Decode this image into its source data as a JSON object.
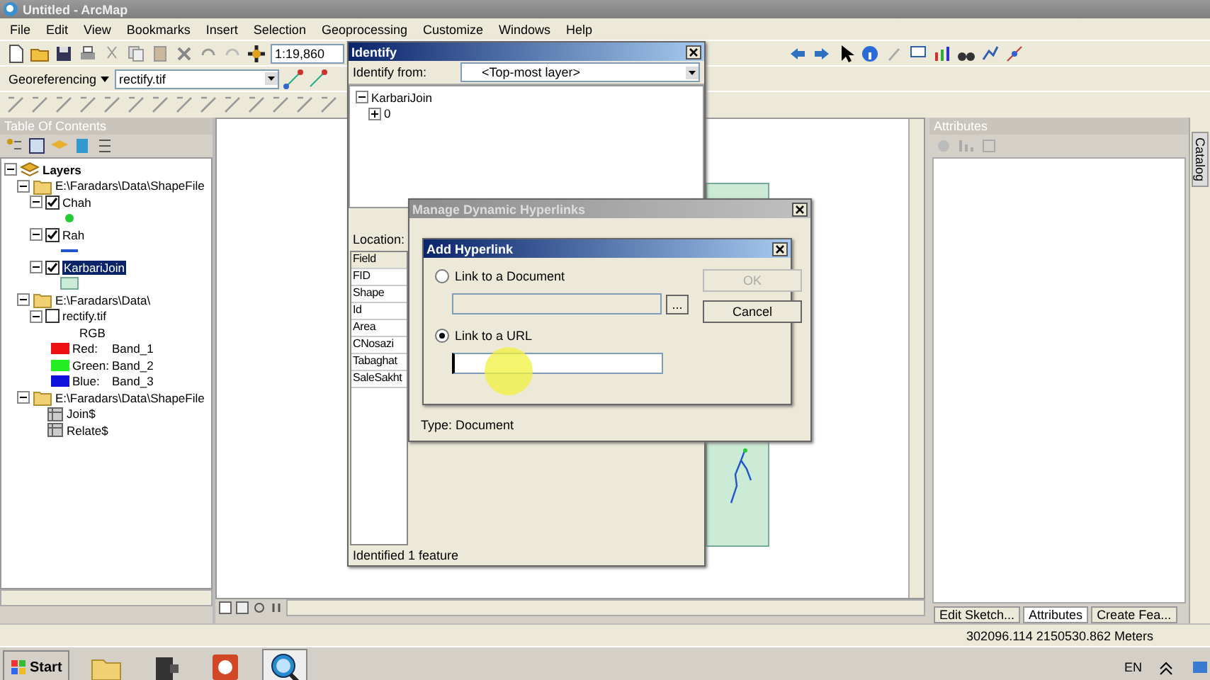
{
  "window": {
    "title": "Untitled - ArcMap"
  },
  "menu": [
    "File",
    "Edit",
    "View",
    "Bookmarks",
    "Insert",
    "Selection",
    "Geoprocessing",
    "Customize",
    "Windows",
    "Help"
  ],
  "standard_toolbar": {
    "scale": "1:19,860"
  },
  "georeferencing_toolbar": {
    "label": "Georeferencing",
    "layer": "rectify.tif"
  },
  "toc": {
    "title": "Table Of Contents",
    "tree": [
      {
        "kind": "group",
        "label": "Layers",
        "expanded": true,
        "children": [
          {
            "kind": "folder",
            "label": "E:\\Faradars\\Data\\ShapeFile",
            "expanded": true,
            "children": [
              {
                "kind": "layer",
                "label": "Chah",
                "checked": true,
                "selected": false,
                "expanded": true,
                "children": [
                  {
                    "kind": "point",
                    "color": "#22cc33"
                  }
                ]
              },
              {
                "kind": "layer",
                "label": "Rah",
                "checked": true,
                "selected": false,
                "expanded": true,
                "children": [
                  {
                    "kind": "line",
                    "color": "#2255cc"
                  }
                ]
              },
              {
                "kind": "layer",
                "label": "KarbariJoin",
                "checked": true,
                "selected": true,
                "expanded": true,
                "children": [
                  {
                    "kind": "fill",
                    "color": "#ccebd6"
                  }
                ]
              }
            ]
          },
          {
            "kind": "folder",
            "label": "E:\\Faradars\\Data\\",
            "expanded": true,
            "children": [
              {
                "kind": "layer",
                "label": "rectify.tif",
                "checked": false,
                "selected": false,
                "expanded": true,
                "children": [
                  {
                    "kind": "caption",
                    "label": "RGB"
                  },
                  {
                    "kind": "band",
                    "label": "Red:",
                    "value": "Band_1",
                    "color": "#ee1111"
                  },
                  {
                    "kind": "band",
                    "label": "Green:",
                    "value": "Band_2",
                    "color": "#22ee22"
                  },
                  {
                    "kind": "band",
                    "label": "Blue:",
                    "value": "Band_3",
                    "color": "#1111dd"
                  }
                ]
              }
            ]
          },
          {
            "kind": "folder",
            "label": "E:\\Faradars\\Data\\ShapeFile",
            "expanded": true,
            "children": [
              {
                "kind": "table",
                "label": "Join$"
              },
              {
                "kind": "table",
                "label": "Relate$"
              }
            ]
          }
        ]
      }
    ]
  },
  "attributes_panel": {
    "title": "Attributes"
  },
  "catalog_tab": "Catalog",
  "bottom_tabs": [
    {
      "label": "Edit Sketch...",
      "selected": false
    },
    {
      "label": "Attributes",
      "selected": true
    },
    {
      "label": "Create Fea...",
      "selected": false
    }
  ],
  "status_bar": {
    "coordinates": "302096.114  2150530.862 Meters"
  },
  "identify": {
    "title": "Identify",
    "from_label": "Identify from:",
    "from_value": "<Top-most layer>",
    "tree": [
      {
        "label": "KarbariJoin",
        "expanded": true,
        "children": [
          {
            "label": "0",
            "expanded": false
          }
        ]
      }
    ],
    "location_label": "Location:",
    "field_header": "Field",
    "fields": [
      "FID",
      "Shape",
      "Id",
      "Area",
      "CNosazi",
      "Tabaghat",
      "SaleSakht"
    ],
    "status": "Identified 1 feature"
  },
  "manage_hyperlinks": {
    "title": "Manage Dynamic Hyperlinks",
    "type_label": "Type: Document"
  },
  "add_hyperlink": {
    "title": "Add Hyperlink",
    "options": [
      {
        "label": "Link to a Document",
        "selected": false,
        "browse": "..."
      },
      {
        "label": "Link to a URL",
        "selected": true
      }
    ],
    "buttons": [
      {
        "label": "OK",
        "disabled": true
      },
      {
        "label": "Cancel",
        "disabled": false
      }
    ]
  },
  "taskbar": {
    "start": "Start",
    "language": "EN"
  }
}
